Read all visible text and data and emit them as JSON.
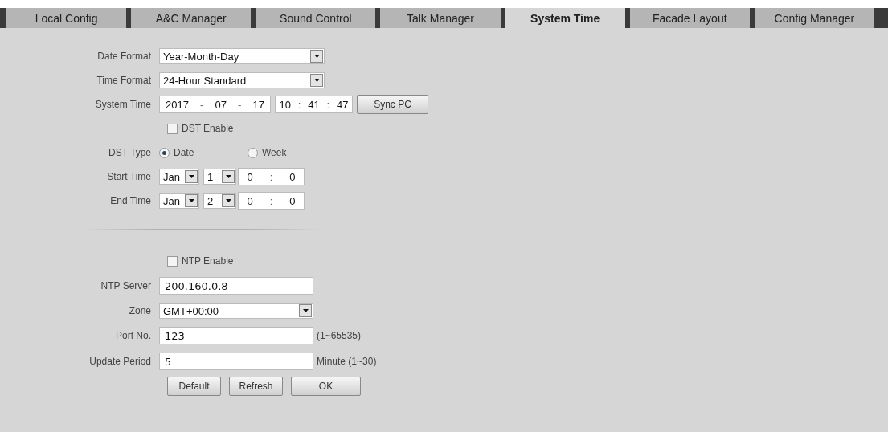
{
  "tabs": [
    {
      "label": "Local Config",
      "selected": false
    },
    {
      "label": "A&C Manager",
      "selected": false
    },
    {
      "label": "Sound Control",
      "selected": false
    },
    {
      "label": "Talk Manager",
      "selected": false
    },
    {
      "label": "System Time",
      "selected": true
    },
    {
      "label": "Facade Layout",
      "selected": false
    },
    {
      "label": "Config Manager",
      "selected": false
    }
  ],
  "rows": [
    {
      "kind": "select",
      "label": "Date Format",
      "value": "Year-Month-Day"
    },
    {
      "kind": "select",
      "label": "Time Format",
      "value": "24-Hour Standard"
    },
    {
      "kind": "datetime",
      "label": "System Time",
      "date": [
        "2017",
        "07",
        "17"
      ],
      "date_separator": "-",
      "time": [
        "10",
        "41",
        "47"
      ],
      "time_separator": ":",
      "button": "Sync PC"
    },
    {
      "kind": "checkbox",
      "label": "DST Enable",
      "checked": false
    },
    {
      "kind": "radio",
      "label": "DST Type",
      "options": [
        {
          "label": "Date",
          "selected": true
        },
        {
          "label": "Week",
          "selected": false
        }
      ]
    },
    {
      "kind": "daterange",
      "label": "Start Time",
      "month": "Jan",
      "day": "1",
      "time": [
        "0",
        "0"
      ],
      "time_separator": ":"
    },
    {
      "kind": "daterange",
      "label": "End Time",
      "month": "Jan",
      "day": "2",
      "time": [
        "0",
        "0"
      ],
      "time_separator": ":"
    },
    {
      "kind": "divider"
    },
    {
      "kind": "checkbox",
      "label": "NTP Enable",
      "checked": false
    },
    {
      "kind": "text",
      "label": "NTP Server",
      "value": "200.160.0.8"
    },
    {
      "kind": "select",
      "label": "Zone",
      "value": "GMT+00:00"
    },
    {
      "kind": "text",
      "label": "Port No.",
      "value": "123",
      "hint": "(1~65535)"
    },
    {
      "kind": "text",
      "label": "Update Period",
      "value": "5",
      "hint": "Minute (1~30)"
    }
  ],
  "buttons": [
    "Default",
    "Refresh",
    "OK"
  ]
}
